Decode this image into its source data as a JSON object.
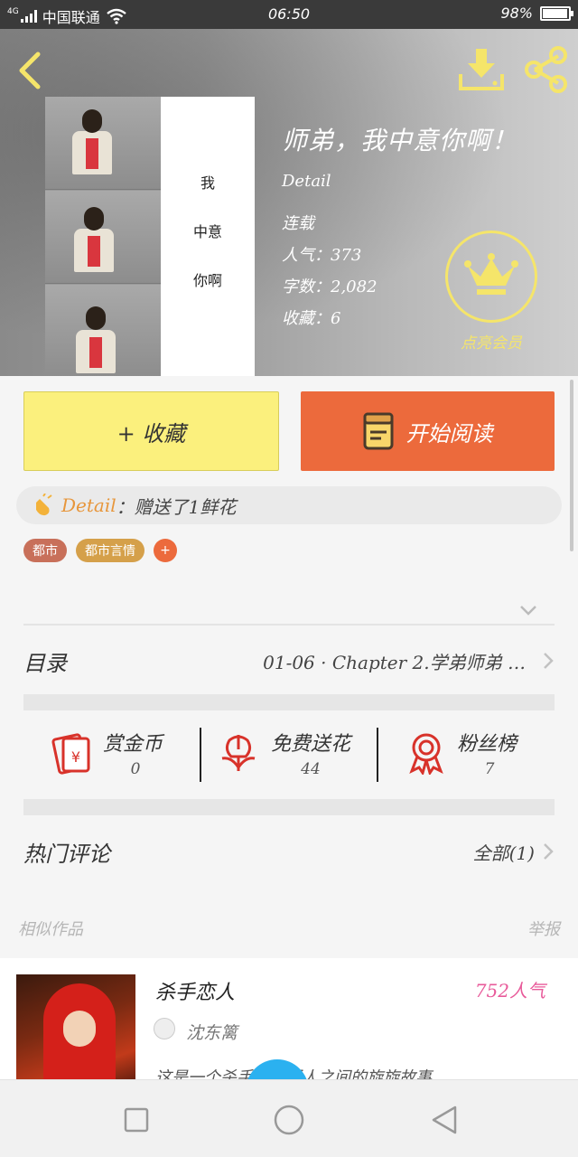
{
  "status_bar": {
    "network": "4G",
    "carrier": "中国联通",
    "time": "06:50",
    "battery_text": "98%",
    "battery_level": 0.98
  },
  "header": {
    "icons": {
      "back": "chevron-left-icon",
      "download": "download-icon",
      "share": "share-icon"
    }
  },
  "cover": {
    "caption_lines": [
      "我",
      "中意",
      "你啊"
    ]
  },
  "book": {
    "title": "师弟，我中意你啊！",
    "author": "Detail",
    "status": "连载",
    "popularity": "人气：373",
    "word_count": "字数：2,082",
    "favorites": "收藏：6"
  },
  "vip": {
    "label": "点亮会员",
    "icon": "crown-icon"
  },
  "actions": {
    "collect_label": "+ 收藏",
    "read_label": "开始阅读",
    "read_icon": "book-icon"
  },
  "gift": {
    "icon": "clap-icon",
    "user": "Detail",
    "message": "：赠送了1鲜花"
  },
  "tags": [
    {
      "label": "都市",
      "color": "#c8705a"
    },
    {
      "label": "都市言情",
      "color": "#d5a04a"
    }
  ],
  "tag_add": "+",
  "catalog": {
    "label": "目录",
    "latest": "01-06 · Chapter 2.学弟师弟 …"
  },
  "stats": [
    {
      "name": "赏金币",
      "value": "0",
      "icon": "red-envelope-icon"
    },
    {
      "name": "免费送花",
      "value": "44",
      "icon": "flower-icon"
    },
    {
      "name": "粉丝榜",
      "value": "7",
      "icon": "medal-icon"
    }
  ],
  "comments": {
    "label": "热门评论",
    "all": "全部(1)"
  },
  "similar": {
    "label": "相似作品",
    "report": "举报"
  },
  "similar_item": {
    "title": "杀手恋人",
    "popularity": "752人气",
    "author": "沈东篱",
    "intro": "这是一个杀手和普通人之间的旋旋故事"
  },
  "colors": {
    "accent_orange": "#ec6a3c",
    "collect_yellow": "#fbf07d",
    "vip_gold": "#f5e56a",
    "popularity_pink": "#e85a9a",
    "icon_red": "#d8322a"
  }
}
